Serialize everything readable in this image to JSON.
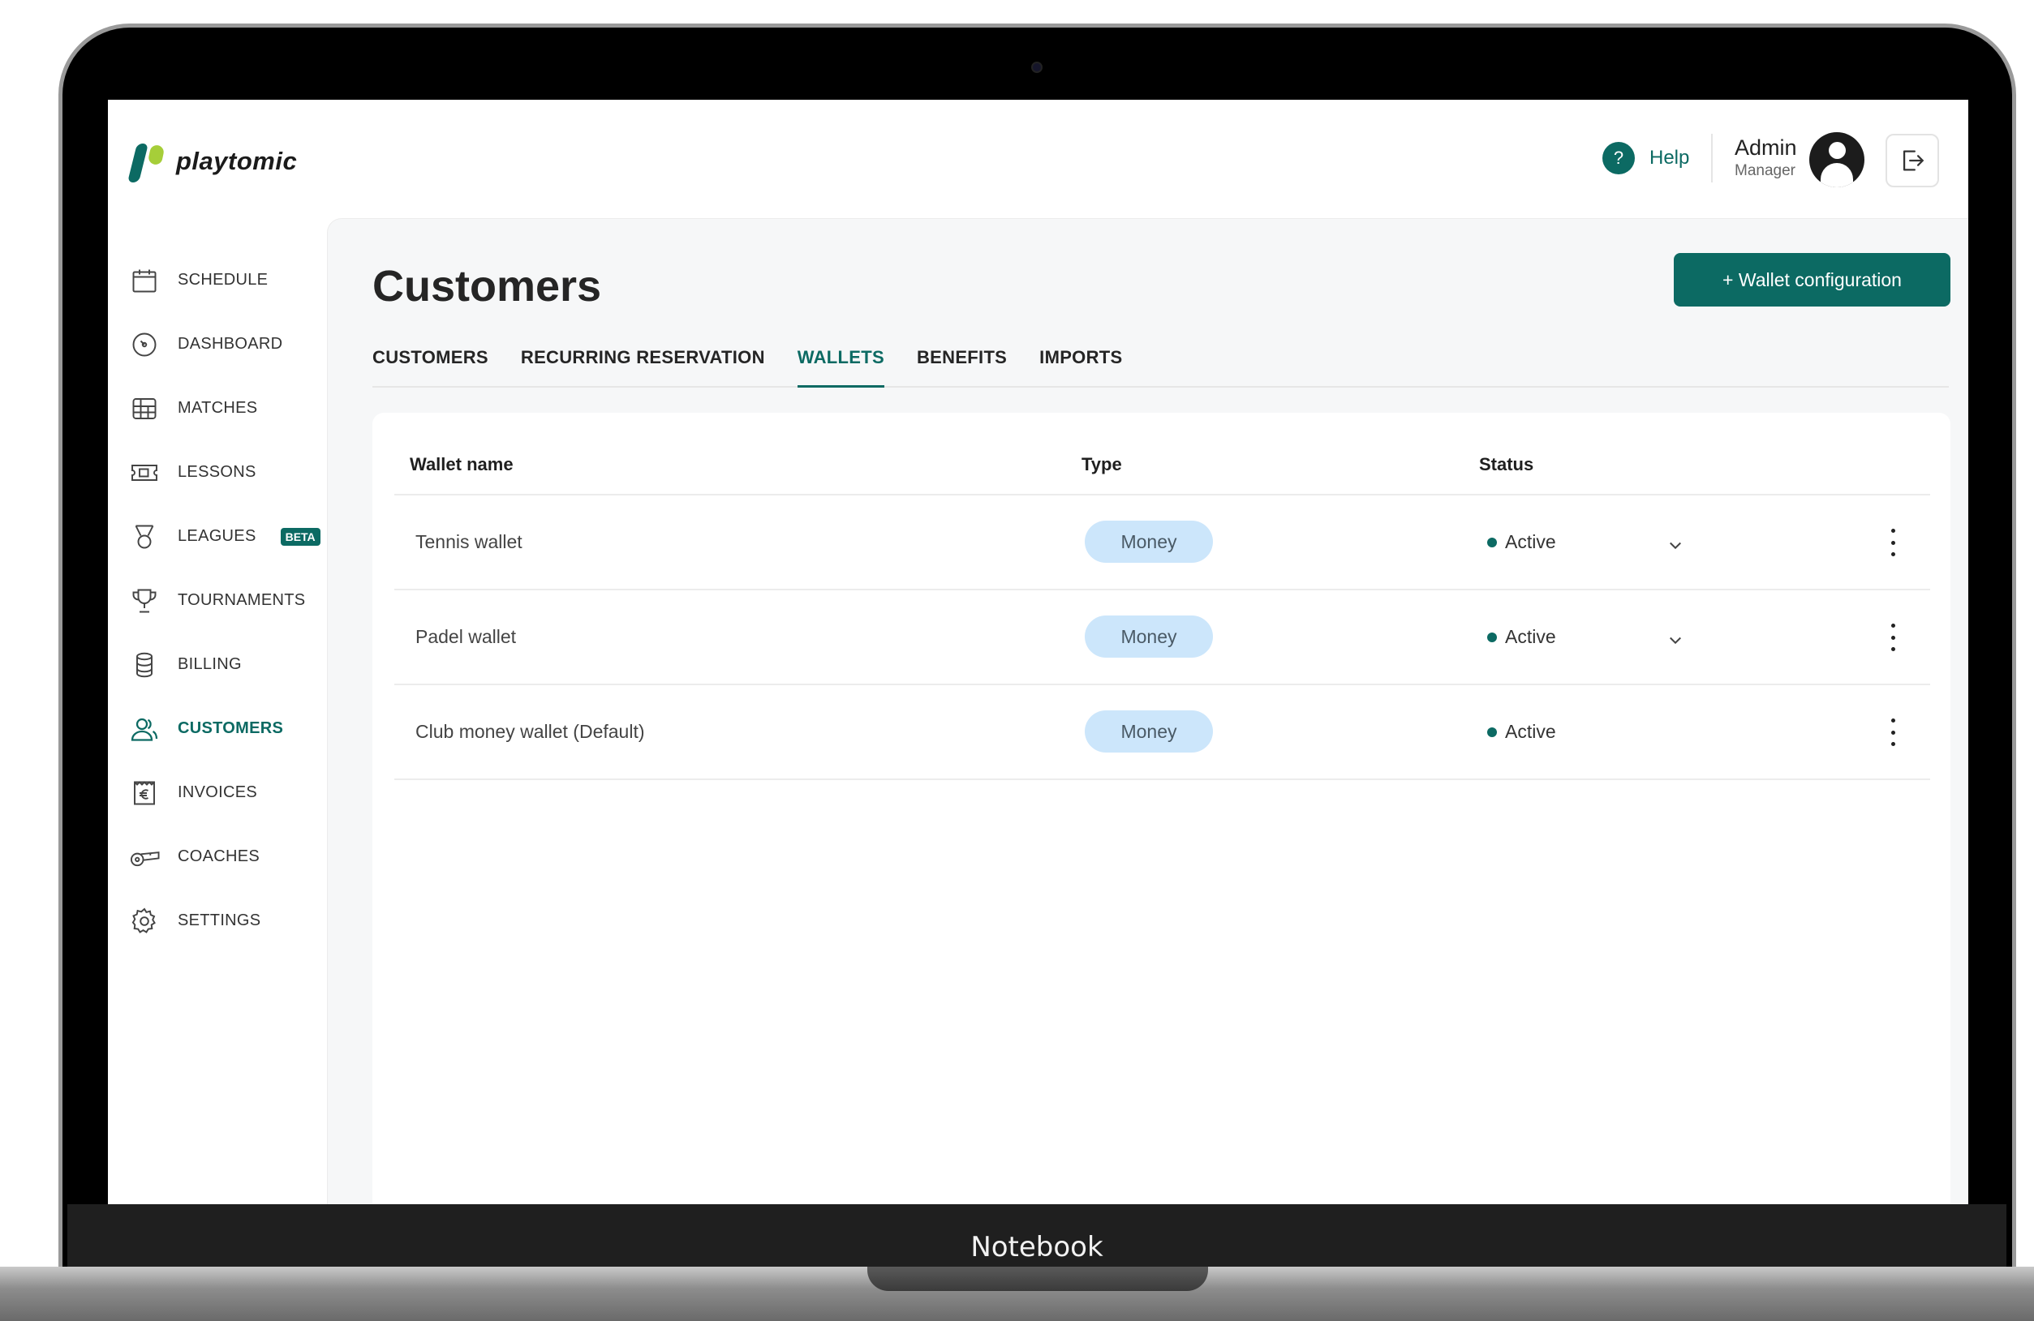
{
  "device": {
    "brand_label": "Notebook"
  },
  "app": {
    "logo_text": "playtomic",
    "brand_color": "#0c6a63",
    "accent_color": "#a6ce39"
  },
  "header": {
    "help_icon": "?",
    "help_label": "Help",
    "user_name": "Admin",
    "user_role": "Manager"
  },
  "sidebar": {
    "items": [
      {
        "label": "SCHEDULE",
        "icon": "calendar-icon"
      },
      {
        "label": "DASHBOARD",
        "icon": "gauge-icon"
      },
      {
        "label": "MATCHES",
        "icon": "court-grid-icon"
      },
      {
        "label": "LESSONS",
        "icon": "ticket-icon"
      },
      {
        "label": "LEAGUES",
        "icon": "medal-icon",
        "badge": "BETA"
      },
      {
        "label": "TOURNAMENTS",
        "icon": "trophy-icon"
      },
      {
        "label": "BILLING",
        "icon": "coins-icon"
      },
      {
        "label": "CUSTOMERS",
        "icon": "users-icon",
        "active": true
      },
      {
        "label": "INVOICES",
        "icon": "euro-invoice-icon"
      },
      {
        "label": "COACHES",
        "icon": "whistle-icon"
      },
      {
        "label": "SETTINGS",
        "icon": "gear-icon"
      }
    ]
  },
  "main": {
    "title": "Customers",
    "action_button": "+ Wallet configuration",
    "tabs": [
      "CUSTOMERS",
      "RECURRING RESERVATION",
      "WALLETS",
      "BENEFITS",
      "IMPORTS"
    ],
    "active_tab": "WALLETS",
    "table": {
      "headers": {
        "name": "Wallet name",
        "type": "Type",
        "status": "Status"
      },
      "rows": [
        {
          "name": "Tennis wallet",
          "type": "Money",
          "status": "Active",
          "has_dropdown": true
        },
        {
          "name": "Padel wallet",
          "type": "Money",
          "status": "Active",
          "has_dropdown": true
        },
        {
          "name": "Club money wallet (Default)",
          "type": "Money",
          "status": "Active",
          "has_dropdown": false
        }
      ]
    }
  }
}
